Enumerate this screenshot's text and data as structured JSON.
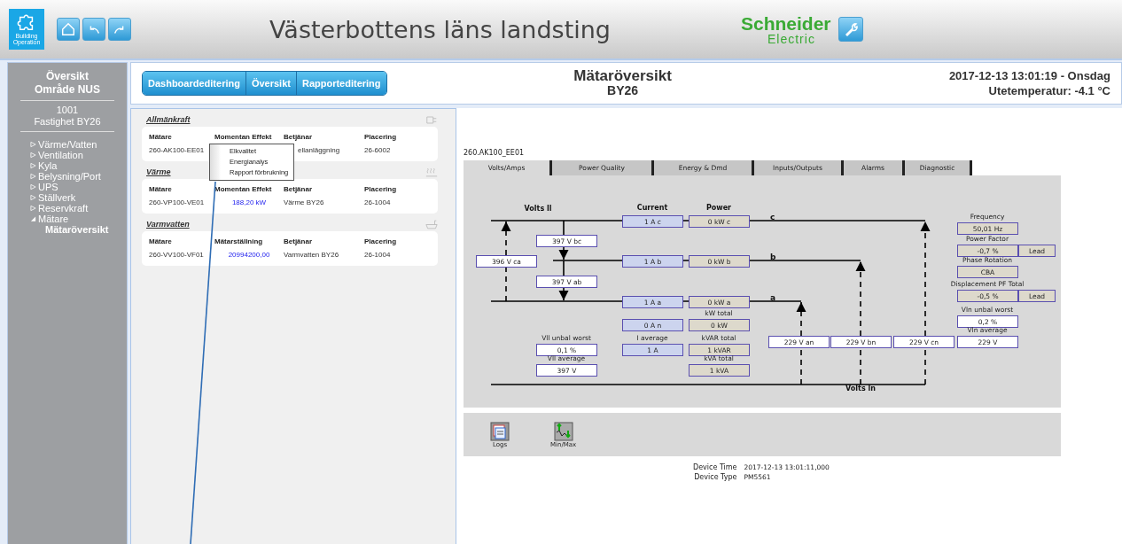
{
  "header": {
    "logo_text": "Building Operation",
    "nav_buttons": [
      {
        "kind": "home"
      },
      {
        "kind": "back"
      },
      {
        "kind": "forward"
      }
    ],
    "title": "Västerbottens läns landsting",
    "brand": {
      "name": "Schneider",
      "sub": "Electric"
    }
  },
  "sidebar": {
    "heading": [
      "Översikt",
      "Område NUS"
    ],
    "subheading": [
      "1001",
      "Fastighet BY26"
    ],
    "tree": [
      {
        "label": "Värme/Vatten",
        "expanded": false
      },
      {
        "label": "Ventilation",
        "expanded": false
      },
      {
        "label": "Kyla",
        "expanded": false
      },
      {
        "label": "Belysning/Port",
        "expanded": false
      },
      {
        "label": "UPS",
        "expanded": false
      },
      {
        "label": "Ställverk",
        "expanded": false
      },
      {
        "label": "Reservkraft",
        "expanded": false
      },
      {
        "label": "Mätare",
        "expanded": true,
        "children": [
          {
            "label": "Mätaröversikt",
            "selected": true
          }
        ]
      }
    ]
  },
  "toolbar_tabs": [
    {
      "label": "Dashboardeditering"
    },
    {
      "label": "Översikt"
    },
    {
      "label": "Rapporteditering"
    }
  ],
  "page_title": "Mätaröversikt",
  "page_subtitle": "BY26",
  "datetime": "2017-12-13 13:01:19 - Onsdag",
  "outdoor_temp": "Utetemperatur: -4.1 °C",
  "sections": [
    {
      "title": "Allmänkraft",
      "kind": "plug",
      "columns": [
        "Mätare",
        "Momentan Effekt",
        "Betjänar",
        "Placering"
      ],
      "rows": [
        {
          "meter": "260-AK100-EE01",
          "served_by": "ellanläggning",
          "location": "26-6002"
        }
      ]
    },
    {
      "title": "Värme",
      "kind": "heat",
      "columns": [
        "Mätare",
        "Momentan Effekt",
        "Betjänar",
        "Placering"
      ],
      "rows": [
        {
          "meter": "260-VP100-VE01",
          "value": "188,20 kW",
          "served_by": "Värme BY26",
          "location": "26-1004"
        }
      ]
    },
    {
      "title": "Varmvatten",
      "kind": "bath",
      "columns": [
        "Mätare",
        "Mätarställning",
        "Betjänar",
        "Placering"
      ],
      "rows": [
        {
          "meter": "260-VV100-VF01",
          "value": "20994200,00",
          "served_by": "Varmvatten BY26",
          "location": "26-1004"
        }
      ]
    }
  ],
  "context_menu": [
    "Elkvalitet",
    "Energianalys",
    "Rapport förbrukning"
  ],
  "device": {
    "name": "260.AK100_EE01",
    "tabs": [
      {
        "label": "Volts/Amps",
        "selected": true
      },
      {
        "label": "Power Quality",
        "selected": false
      },
      {
        "label": "Energy & Dmd",
        "selected": false
      },
      {
        "label": "Inputs/Outputs",
        "selected": false
      },
      {
        "label": "Alarms",
        "selected": false
      },
      {
        "label": "Diagnostic",
        "selected": false
      }
    ],
    "diagram_labels": [
      {
        "text": "Volts ll",
        "kind": "heading"
      },
      {
        "text": "Current",
        "kind": "heading"
      },
      {
        "text": "Power",
        "kind": "heading"
      },
      {
        "text": "c",
        "kind": "phase"
      },
      {
        "text": "b",
        "kind": "phase"
      },
      {
        "text": "a",
        "kind": "phase"
      },
      {
        "text": "Volts ln",
        "kind": "heading"
      }
    ],
    "boxes": [
      {
        "kind": "current",
        "value": "1 A c"
      },
      {
        "kind": "power",
        "value": "0 kW c"
      },
      {
        "kind": "voltage",
        "value": "397 V bc"
      },
      {
        "kind": "voltage",
        "value": "396 V ca"
      },
      {
        "kind": "current",
        "value": "1 A b"
      },
      {
        "kind": "power",
        "value": "0 kW b"
      },
      {
        "kind": "voltage",
        "value": "397 V ab"
      },
      {
        "kind": "current",
        "value": "1 A a"
      },
      {
        "kind": "power",
        "value": "0 kW a"
      },
      {
        "kind": "current",
        "value": "0 A n"
      },
      {
        "kind": "power",
        "value": "0 kW",
        "label": "kW total"
      },
      {
        "kind": "voltage",
        "value": "0,1 %",
        "label": "Vll unbal worst"
      },
      {
        "kind": "current",
        "value": "1 A",
        "label": "I average"
      },
      {
        "kind": "power",
        "value": "1 kVAR",
        "label": "kVAR total"
      },
      {
        "kind": "voltage",
        "value": "397 V",
        "label": "Vll average"
      },
      {
        "kind": "power",
        "value": "1 kVA",
        "label": "kVA total"
      },
      {
        "kind": "voltage",
        "value": "229 V an"
      },
      {
        "kind": "voltage",
        "value": "229 V bn"
      },
      {
        "kind": "voltage",
        "value": "229 V cn"
      },
      {
        "kind": "power",
        "value": "50,01 Hz",
        "label": "Frequency"
      },
      {
        "kind": "power",
        "value": "-0,7 %",
        "label": "Power Factor",
        "extra": "Lead"
      },
      {
        "kind": "power",
        "value": "CBA",
        "label": "Phase Rotation"
      },
      {
        "kind": "power",
        "value": "-0,5 %",
        "label": "Displacement PF Total",
        "extra": "Lead"
      },
      {
        "kind": "voltage",
        "value": "0,2 %",
        "label": "Vln unbal worst"
      },
      {
        "kind": "voltage",
        "value": "229 V",
        "label": "Vln average"
      }
    ],
    "tools": [
      {
        "kind": "logs",
        "label": "Logs"
      },
      {
        "kind": "minmax",
        "label": "Min/Max"
      }
    ],
    "info": [
      {
        "label": "Device Time",
        "value": "2017-12-13 13:01:11,000"
      },
      {
        "label": "Device Type",
        "value": "PM5561"
      }
    ]
  }
}
